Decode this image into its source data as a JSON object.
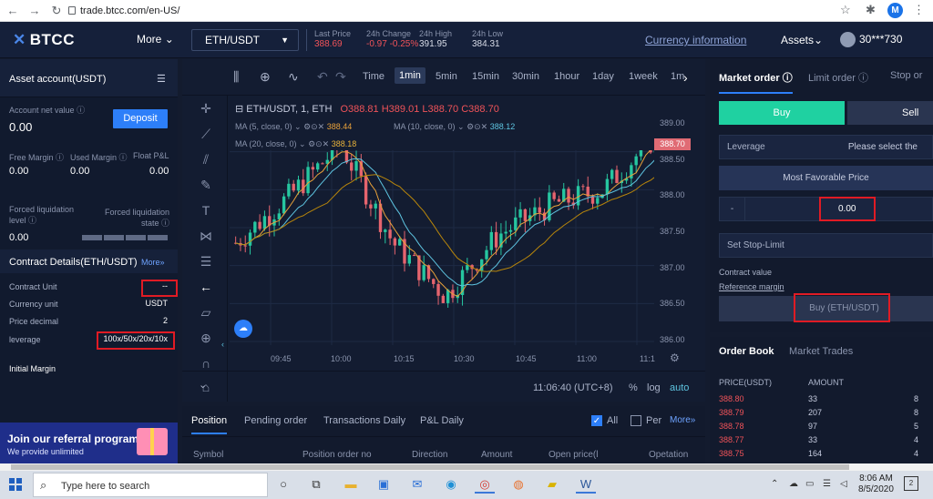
{
  "browser": {
    "url": "trade.btcc.com/en-US/",
    "profile_initial": "M"
  },
  "header": {
    "logo": "BTCC",
    "more": "More",
    "pair": "ETH/USDT",
    "last_price_label": "Last Price",
    "last_price": "388.69",
    "change_label": "24h Change",
    "change": "-0.97 -0.25%",
    "high_label": "24h High",
    "high": "391.95",
    "low_label": "24h Low",
    "low": "384.31",
    "currency_info": "Currency information",
    "assets": "Assets",
    "user": "30***730"
  },
  "account": {
    "title": "Asset account(USDT)",
    "net_value_label": "Account net value",
    "net_value": "0.00",
    "deposit": "Deposit",
    "free_margin_label": "Free Margin",
    "free_margin": "0.00",
    "used_margin_label": "Used Margin",
    "used_margin": "0.00",
    "float_pl_label": "Float P&L",
    "float_pl": "0.00",
    "forced_level_label": "Forced liquidation level",
    "forced_level": "0.00",
    "forced_state_label": "Forced liquidation state"
  },
  "contract": {
    "title": "Contract Details(ETH/USDT)",
    "more": "More",
    "rows": [
      {
        "k": "Contract Unit",
        "v": "--"
      },
      {
        "k": "Currency unit",
        "v": "USDT"
      },
      {
        "k": "Price decimal",
        "v": "2"
      },
      {
        "k": "leverage",
        "v": "100x/50x/20x/10x"
      }
    ],
    "initial_margin": "Initial Margin"
  },
  "banner": {
    "title": "Join our referral program",
    "subtitle": "We provide unlimited"
  },
  "chart": {
    "timeframes": [
      "Time",
      "1min",
      "5min",
      "15min",
      "30min",
      "1hour",
      "1day",
      "1week",
      "1m"
    ],
    "active_timeframe": "1min",
    "symbol_line": "ETH/USDT, 1, ETH",
    "ohlc": {
      "o": "O388.81",
      "h": "H389.01",
      "l": "L388.70",
      "c": "C388.70"
    },
    "ma5_label": "MA (5, close, 0)",
    "ma5_value": "388.44",
    "ma10_label": "MA (10, close, 0)",
    "ma10_value": "388.12",
    "ma20_label": "MA (20, close, 0)",
    "ma20_value": "388.18",
    "price_ticks": [
      "389.00",
      "388.50",
      "388.00",
      "387.50",
      "387.00",
      "386.50",
      "386.00"
    ],
    "current_price_tag": "388.70",
    "time_ticks": [
      "09:45",
      "10:00",
      "10:15",
      "10:30",
      "10:45",
      "11:00",
      "11:1"
    ],
    "clock": "11:06:40 (UTC+8)",
    "pct": "%",
    "log": "log",
    "auto": "auto"
  },
  "chart_data": {
    "type": "candlestick",
    "ylim": [
      386.0,
      389.0
    ],
    "x": [
      "09:45",
      "10:00",
      "10:15",
      "10:30",
      "10:45",
      "11:00"
    ],
    "close_trend": [
      387.3,
      387.9,
      388.6,
      387.3,
      386.6,
      387.4,
      387.8,
      388.0,
      388.7
    ],
    "current": 388.7,
    "colors": {
      "up": "#26c6a0",
      "down": "#e5646e",
      "ma5": "#e8a13a",
      "ma10": "#5ec4e0",
      "ma20": "#b8860b"
    }
  },
  "orders": {
    "tabs": [
      "Position",
      "Pending order",
      "Transactions Daily",
      "P&L Daily"
    ],
    "all": "All",
    "per": "Per",
    "more": "More",
    "columns": [
      "Symbol",
      "Position order no",
      "Direction",
      "Amount",
      "Open price(l",
      "Opetation"
    ]
  },
  "trade": {
    "tab_market": "Market order",
    "tab_limit": "Limit order",
    "tab_stop": "Stop or",
    "buy": "Buy",
    "sell": "Sell",
    "leverage_label": "Leverage",
    "leverage_placeholder": "Please select the",
    "mfp": "Most Favorable Price",
    "minus": "-",
    "qty": "0.00",
    "stop_limit": "Set Stop-Limit",
    "contract_value": "Contract value",
    "ref_margin": "Reference margin",
    "buy_pair": "Buy (ETH/USDT)"
  },
  "orderbook": {
    "tab_book": "Order Book",
    "tab_trades": "Market Trades",
    "col_price": "PRICE(USDT)",
    "col_amount": "AMOUNT",
    "rows": [
      {
        "p": "388.80",
        "a": "33",
        "t": "8"
      },
      {
        "p": "388.79",
        "a": "207",
        "t": "8"
      },
      {
        "p": "388.78",
        "a": "97",
        "t": "5"
      },
      {
        "p": "388.77",
        "a": "33",
        "t": "4"
      },
      {
        "p": "388.75",
        "a": "164",
        "t": "4"
      }
    ]
  },
  "taskbar": {
    "search": "Type here to search",
    "time": "8:06 AM",
    "date": "8/5/2020",
    "notif": "2"
  }
}
